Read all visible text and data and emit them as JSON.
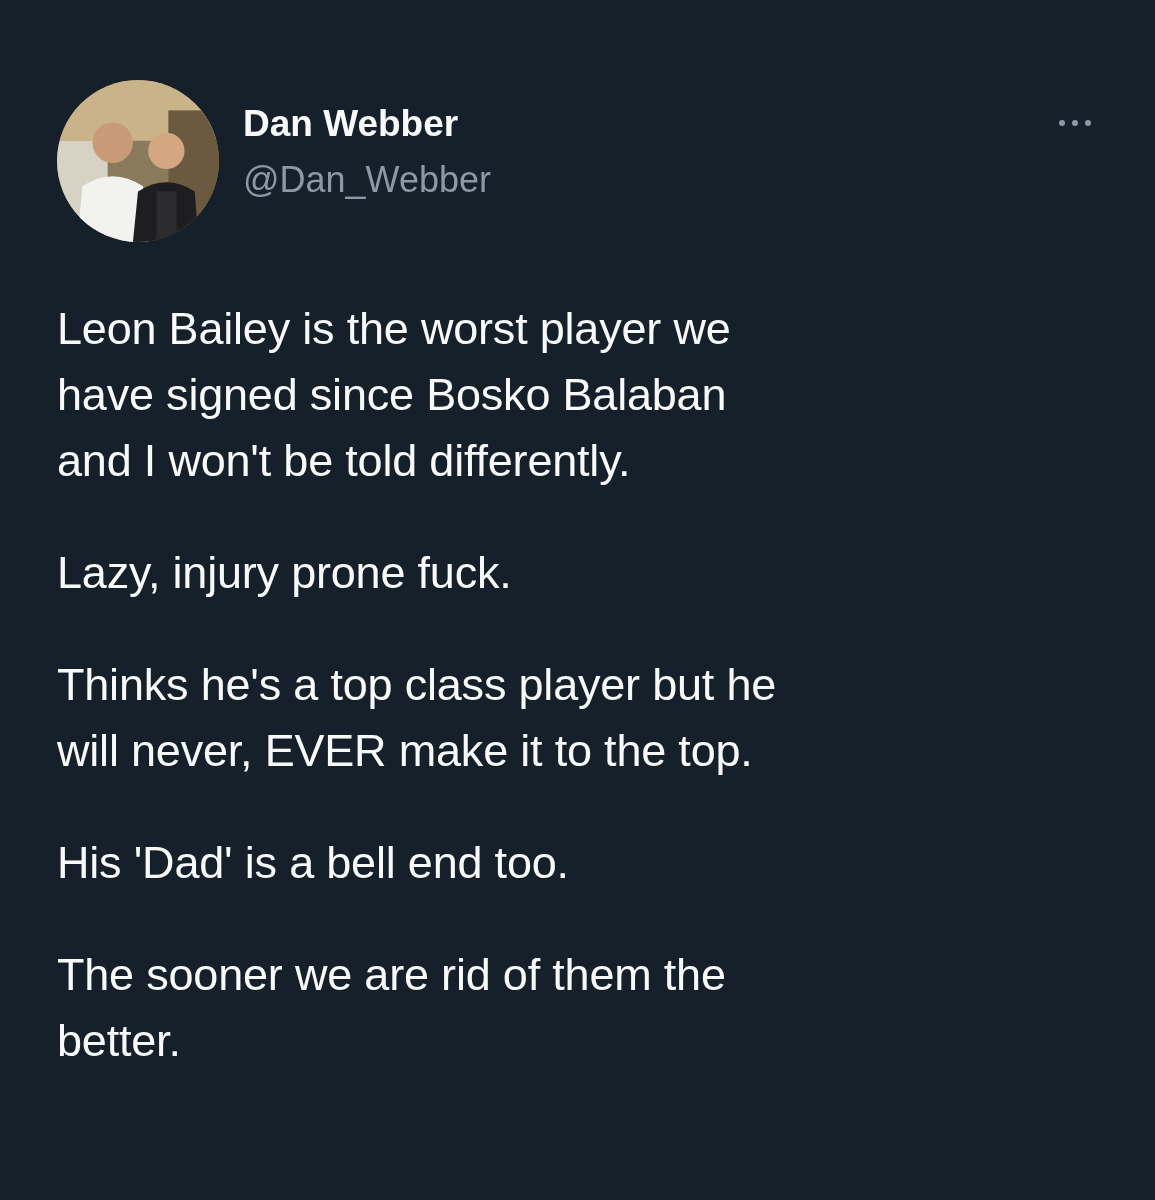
{
  "tweet": {
    "author": {
      "name": "Dan Webber",
      "handle": "@Dan_Webber"
    },
    "more_menu": {
      "kind": "dots"
    },
    "paragraphs": [
      {
        "lines": [
          "Leon Bailey is the worst player we",
          "have signed since Bosko Balaban",
          "and I won't be told differently."
        ]
      },
      {
        "lines": [
          "Lazy, injury prone fuck."
        ]
      },
      {
        "lines": [
          "Thinks he's a top class player but he",
          "will never, EVER make it to the top."
        ]
      },
      {
        "lines": [
          "His 'Dad' is a bell end too."
        ]
      },
      {
        "lines": [
          "The sooner we are rid of them the",
          "better."
        ]
      }
    ]
  }
}
